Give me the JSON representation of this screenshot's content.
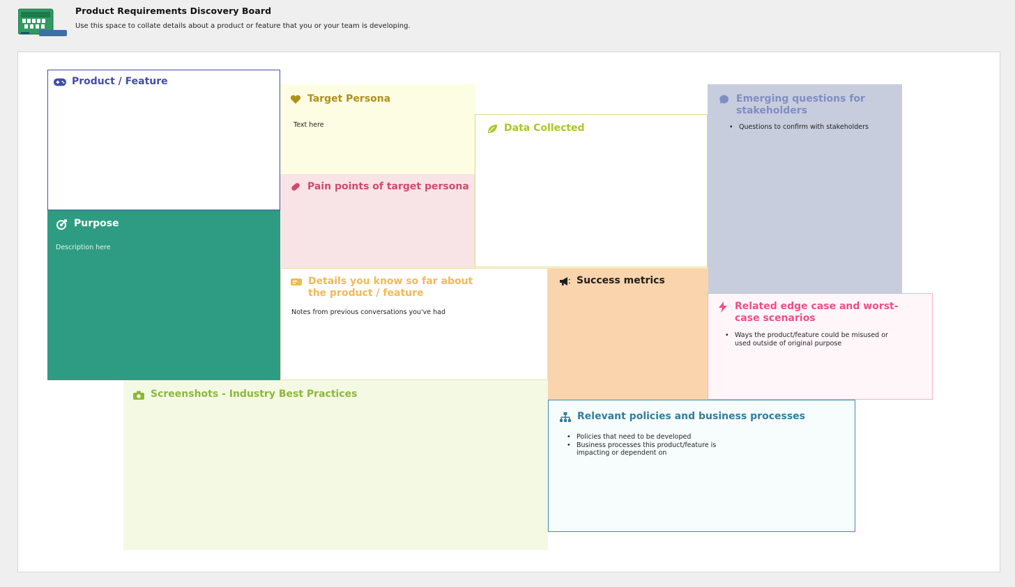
{
  "header": {
    "title": "Product Requirements Discovery Board",
    "subtitle": "Use this space to collate details about a product or feature that you or your team is developing."
  },
  "colors": {
    "product": "#3f4ea3",
    "purpose": "#2e9c82",
    "persona": "#b09118",
    "pain": "#cf4a6e",
    "data": "#a9c728",
    "emerging": "#7f8ec2",
    "details": "#f1b955",
    "success": "#1d1d1d",
    "edge": "#ec4f84",
    "screens": "#8db83a",
    "policies": "#2d7fa0"
  },
  "cards": {
    "product": {
      "title": "Product / Feature",
      "icon": "gamepad-icon"
    },
    "purpose": {
      "title": "Purpose",
      "icon": "target-arrow-icon",
      "text": "Description here"
    },
    "persona": {
      "title": "Target Persona",
      "icon": "heart-icon",
      "text": "Text here"
    },
    "pain": {
      "title": "Pain points of target persona",
      "icon": "pill-icon"
    },
    "data": {
      "title": "Data Collected",
      "icon": "leaf-icon"
    },
    "emerging": {
      "title": "Emerging questions for stakeholders",
      "icon": "speech-bubble-icon",
      "bullets": [
        "Questions to confirm with stakeholders"
      ]
    },
    "details": {
      "title": "Details you know so far about the product / feature",
      "icon": "ticket-icon",
      "text": "Notes from previous conversations you've had"
    },
    "success": {
      "title": "Success metrics",
      "icon": "megaphone-icon"
    },
    "edge": {
      "title": "Related edge case and worst-case scenarios",
      "icon": "lightning-icon",
      "bullets": [
        "Ways the product/feature could be misused or used outside of original purpose"
      ]
    },
    "screens": {
      "title": "Screenshots - Industry Best Practices",
      "icon": "camera-icon"
    },
    "policies": {
      "title": "Relevant policies and business processes",
      "icon": "org-chart-icon",
      "bullets": [
        "Policies that need to be developed",
        "Business processes this product/feature is impacting or dependent on"
      ]
    }
  }
}
